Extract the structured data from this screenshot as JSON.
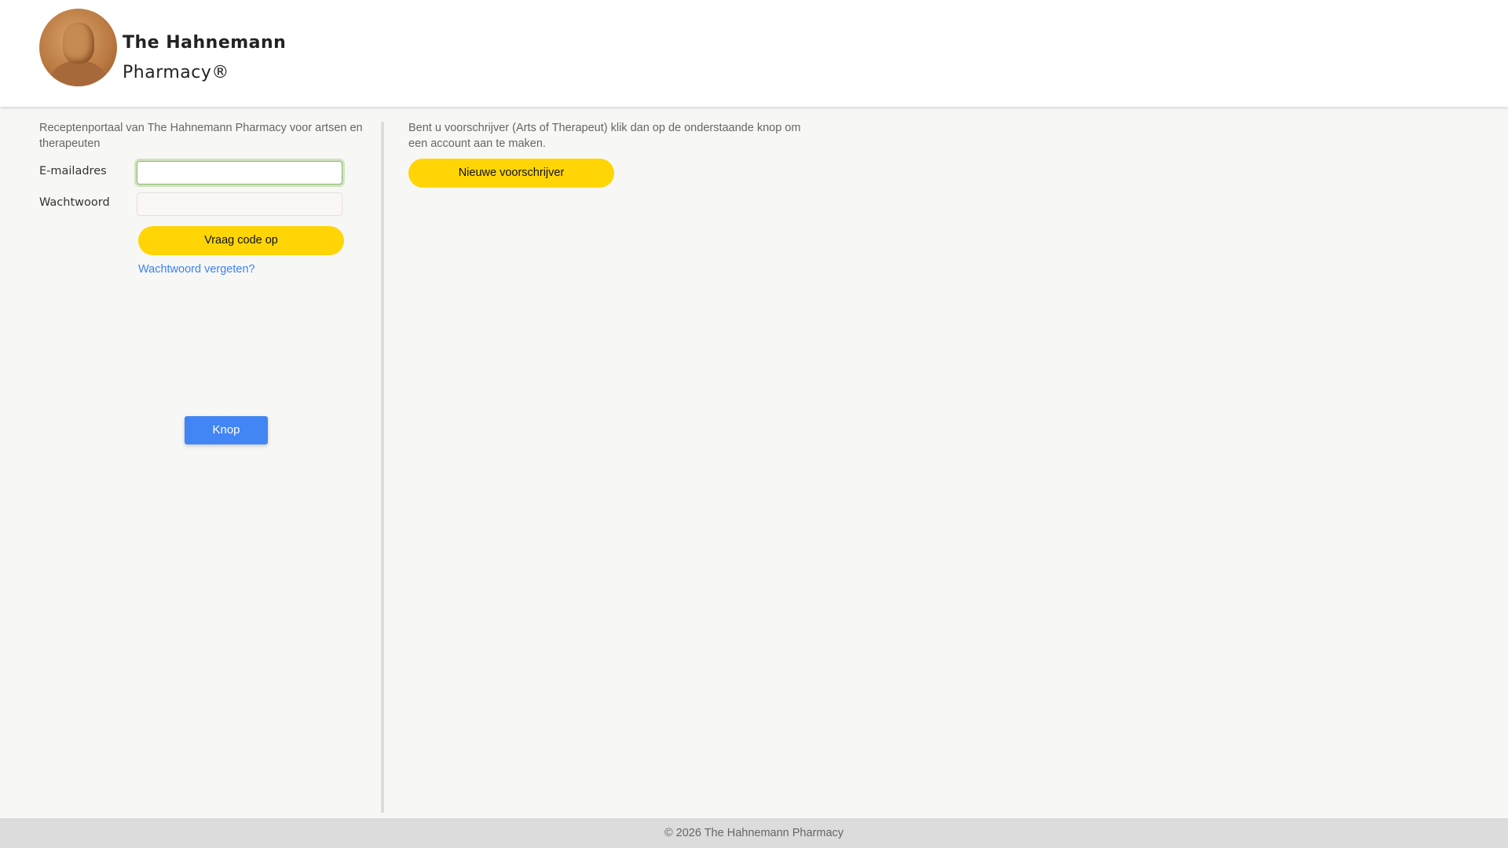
{
  "header": {
    "title_line1": "The Hahnemann",
    "title_line2": "Pharmacy®",
    "logo_alt": "Hahnemann portrait medallion"
  },
  "login": {
    "intro": "Receptenportaal van The Hahnemann Pharmacy voor artsen en therapeuten",
    "email_label": "E-mailadres",
    "email_value": "",
    "password_label": "Wachtwoord",
    "password_value": "",
    "submit_label": "Vraag code op",
    "forgot_link": "Wachtwoord vergeten?",
    "knop_label": "Knop"
  },
  "register": {
    "text": "Bent u voorschrijver (Arts of Therapeut) klik dan op de onderstaande knop om een account aan te maken.",
    "button_label": "Nieuwe voorschrijver"
  },
  "footer": {
    "text": "© 2026 The Hahnemann Pharmacy"
  },
  "colors": {
    "accent_yellow": "#ffd506",
    "link_blue": "#3b82f6",
    "button_blue": "#4285f4"
  }
}
